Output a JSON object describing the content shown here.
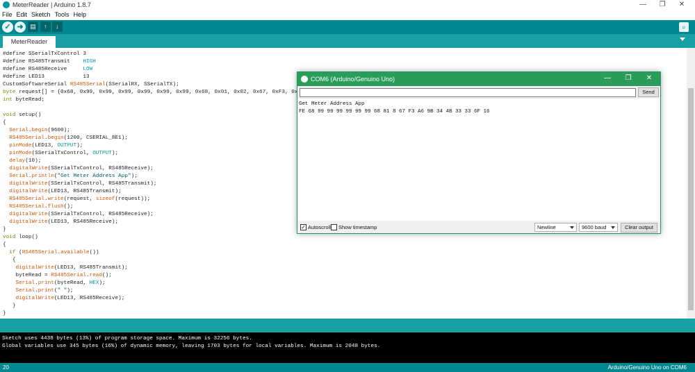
{
  "window": {
    "title": "MeterReader | Arduino 1.8.7"
  },
  "window_controls": {
    "minimize": "—",
    "maximize": "❐",
    "close": "✕"
  },
  "menu": [
    "File",
    "Edit",
    "Sketch",
    "Tools",
    "Help"
  ],
  "toolbar": {
    "verify": "✓",
    "upload": "➜",
    "new": "▤",
    "open": "↑",
    "save": "↓",
    "serial_monitor": "⌕"
  },
  "tabs": [
    {
      "label": "MeterReader"
    }
  ],
  "editor": {
    "lines": [
      "#define SSerialTxControl 3",
      "#define RS485Transmit    HIGH",
      "#define RS485Receive     LOW",
      "#define LED13            13",
      "CustomSoftwareSerial RS485Serial(SSerialRX, SSerialTX);",
      "byte request[] = {0x68, 0x99, 0x99, 0x99, 0x99, 0x99, 0x99, 0x68, 0x01, 0x02, 0x67, 0xF3, 0x",
      "int byteRead;",
      "",
      "void setup()",
      "{",
      "  Serial.begin(9600);",
      "  RS485Serial.begin(1200, CSERIAL_8E1);",
      "  pinMode(LED13, OUTPUT);",
      "  pinMode(SSerialTxControl, OUTPUT);",
      "  delay(10);",
      "  digitalWrite(SSerialTxControl, RS485Receive);",
      "  Serial.println(\"Get Meter Address App\");",
      "  digitalWrite(SSerialTxControl, RS485Transmit);",
      "  digitalWrite(LED13, RS485Transmit);",
      "  RS485Serial.write(request, sizeof(request));",
      "  RS485Serial.flush();",
      "  digitalWrite(SSerialTxControl, RS485Receive);",
      "  digitalWrite(LED13, RS485Receive);",
      "}",
      "void loop()",
      "{",
      "  if (RS485Serial.available())",
      "   {",
      "    digitalWrite(LED13, RS485Transmit);",
      "    byteRead = RS485Serial.read();",
      "    Serial.print(byteRead, HEX);",
      "    Serial.print(\" \");",
      "    digitalWrite(LED13, RS485Receive);",
      "   }",
      "}"
    ]
  },
  "console": {
    "lines": [
      "Sketch uses 4438 bytes (13%) of program storage space. Maximum is 32256 bytes.",
      "Global variables use 345 bytes (16%) of dynamic memory, leaving 1703 bytes for local variables. Maximum is 2048 bytes."
    ]
  },
  "status": {
    "line_number": "20",
    "board": "Arduino/Genuino Uno on COM6"
  },
  "serial_monitor": {
    "title": "COM6 (Arduino/Genuino Uno)",
    "input_value": "",
    "send_label": "Send",
    "output_lines": [
      "Get Meter Address App",
      "FE 68 99 99 99 99 99 99 68 81 8 67 F3 A6 9B 34 4B 33 33 6F 16"
    ],
    "autoscroll": {
      "label": "Autoscroll",
      "checked": true
    },
    "timestamp": {
      "label": "Show timestamp",
      "checked": false
    },
    "line_ending": "Newline",
    "baud": "9600 baud",
    "clear_label": "Clear output"
  }
}
